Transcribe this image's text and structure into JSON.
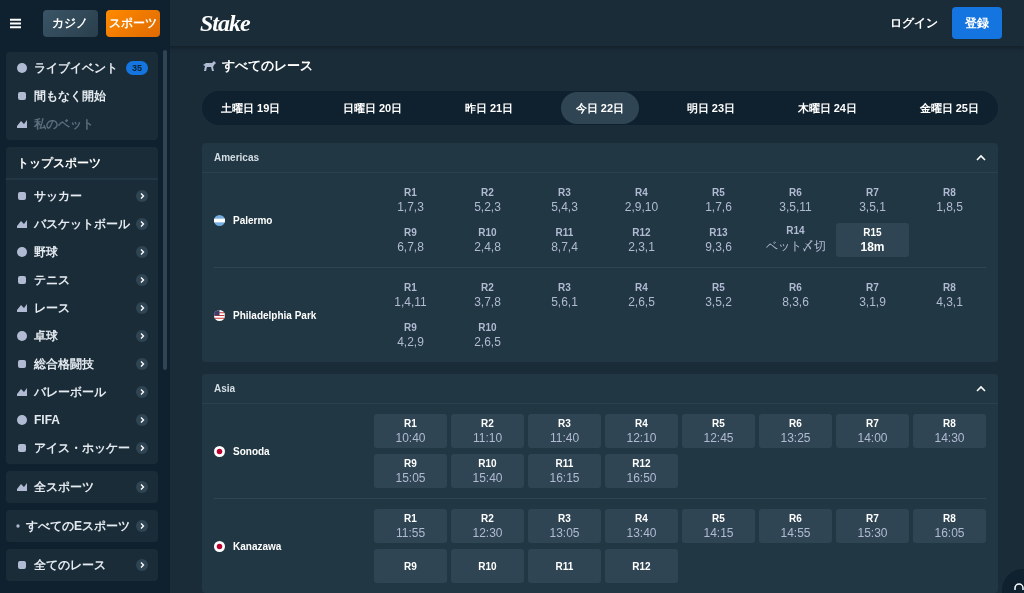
{
  "header": {
    "tabs": [
      {
        "label": "カジノ",
        "selected": false
      },
      {
        "label": "スポーツ",
        "selected": true
      }
    ],
    "logo": "Stake",
    "login": "ログイン",
    "register": "登録"
  },
  "sidebar": {
    "groups": [
      {
        "kind": "menu",
        "items": [
          {
            "label": "ライブイベント",
            "badge": "35",
            "disabled": false
          },
          {
            "label": "間もなく開始",
            "disabled": false
          },
          {
            "label": "私のベット",
            "disabled": true
          }
        ]
      },
      {
        "kind": "list",
        "title": "トップスポーツ",
        "items": [
          {
            "label": "サッカー"
          },
          {
            "label": "バスケットボール"
          },
          {
            "label": "野球"
          },
          {
            "label": "テニス"
          },
          {
            "label": "レース"
          },
          {
            "label": "卓球"
          },
          {
            "label": "総合格闘技"
          },
          {
            "label": "バレーボール"
          },
          {
            "label": "FIFA"
          },
          {
            "label": "アイス・ホッケー"
          }
        ]
      },
      {
        "kind": "list",
        "items": [
          {
            "label": "全スポーツ"
          }
        ]
      },
      {
        "kind": "list",
        "items": [
          {
            "label": "すべてのEスポーツ"
          }
        ]
      },
      {
        "kind": "list",
        "items": [
          {
            "label": "全てのレース"
          }
        ]
      }
    ]
  },
  "page": {
    "title": "すべてのレース",
    "dates": [
      {
        "label": "土曜日 19日",
        "selected": false
      },
      {
        "label": "日曜日 20日",
        "selected": false
      },
      {
        "label": "昨日 21日",
        "selected": false
      },
      {
        "label": "今日 22日",
        "selected": true
      },
      {
        "label": "明日 23日",
        "selected": false
      },
      {
        "label": "木曜日 24日",
        "selected": false
      },
      {
        "label": "金曜日 25日",
        "selected": false
      }
    ],
    "regions": [
      {
        "name": "Americas",
        "expanded": true,
        "tracks": [
          {
            "name": "Palermo",
            "kind": "argentina",
            "races": [
              {
                "kind": "result",
                "label": "R1",
                "info": "1,7,3"
              },
              {
                "kind": "result",
                "label": "R2",
                "info": "5,2,3"
              },
              {
                "kind": "result",
                "label": "R3",
                "info": "5,4,3"
              },
              {
                "kind": "result",
                "label": "R4",
                "info": "2,9,10"
              },
              {
                "kind": "result",
                "label": "R5",
                "info": "1,7,6"
              },
              {
                "kind": "result",
                "label": "R6",
                "info": "3,5,11"
              },
              {
                "kind": "result",
                "label": "R7",
                "info": "3,5,1"
              },
              {
                "kind": "result",
                "label": "R8",
                "info": "1,8,5"
              },
              {
                "kind": "result",
                "label": "R9",
                "info": "6,7,8"
              },
              {
                "kind": "result",
                "label": "R10",
                "info": "2,4,8"
              },
              {
                "kind": "result",
                "label": "R11",
                "info": "8,7,4"
              },
              {
                "kind": "result",
                "label": "R12",
                "info": "2,3,1"
              },
              {
                "kind": "result",
                "label": "R13",
                "info": "9,3,6"
              },
              {
                "kind": "result",
                "label": "R14",
                "info": "ベット〆切"
              },
              {
                "kind": "next",
                "label": "R15",
                "info": "18m"
              }
            ]
          },
          {
            "name": "Philadelphia Park",
            "kind": "usa",
            "races": [
              {
                "kind": "result",
                "label": "R1",
                "info": "1,4,11"
              },
              {
                "kind": "result",
                "label": "R2",
                "info": "3,7,8"
              },
              {
                "kind": "result",
                "label": "R3",
                "info": "5,6,1"
              },
              {
                "kind": "result",
                "label": "R4",
                "info": "2,6,5"
              },
              {
                "kind": "result",
                "label": "R5",
                "info": "3,5,2"
              },
              {
                "kind": "result",
                "label": "R6",
                "info": "8,3,6"
              },
              {
                "kind": "result",
                "label": "R7",
                "info": "3,1,9"
              },
              {
                "kind": "result",
                "label": "R8",
                "info": "4,3,1"
              },
              {
                "kind": "result",
                "label": "R9",
                "info": "4,2,9"
              },
              {
                "kind": "result",
                "label": "R10",
                "info": "2,6,5"
              }
            ]
          }
        ]
      },
      {
        "name": "Asia",
        "expanded": true,
        "tracks": [
          {
            "name": "Sonoda",
            "kind": "japan",
            "races": [
              {
                "kind": "upcoming",
                "label": "R1",
                "info": "10:40"
              },
              {
                "kind": "upcoming",
                "label": "R2",
                "info": "11:10"
              },
              {
                "kind": "upcoming",
                "label": "R3",
                "info": "11:40"
              },
              {
                "kind": "upcoming",
                "label": "R4",
                "info": "12:10"
              },
              {
                "kind": "upcoming",
                "label": "R5",
                "info": "12:45"
              },
              {
                "kind": "upcoming",
                "label": "R6",
                "info": "13:25"
              },
              {
                "kind": "upcoming",
                "label": "R7",
                "info": "14:00"
              },
              {
                "kind": "upcoming",
                "label": "R8",
                "info": "14:30"
              },
              {
                "kind": "upcoming",
                "label": "R9",
                "info": "15:05"
              },
              {
                "kind": "upcoming",
                "label": "R10",
                "info": "15:40"
              },
              {
                "kind": "upcoming",
                "label": "R11",
                "info": "16:15"
              },
              {
                "kind": "upcoming",
                "label": "R12",
                "info": "16:50"
              }
            ]
          },
          {
            "name": "Kanazawa",
            "kind": "japan",
            "races": [
              {
                "kind": "upcoming",
                "label": "R1",
                "info": "11:55"
              },
              {
                "kind": "upcoming",
                "label": "R2",
                "info": "12:30"
              },
              {
                "kind": "upcoming",
                "label": "R3",
                "info": "13:05"
              },
              {
                "kind": "upcoming",
                "label": "R4",
                "info": "13:40"
              },
              {
                "kind": "upcoming",
                "label": "R5",
                "info": "14:15"
              },
              {
                "kind": "upcoming",
                "label": "R6",
                "info": "14:55"
              },
              {
                "kind": "upcoming",
                "label": "R7",
                "info": "15:30"
              },
              {
                "kind": "upcoming",
                "label": "R8",
                "info": "16:05"
              },
              {
                "kind": "upcoming",
                "label": "R9"
              },
              {
                "kind": "upcoming",
                "label": "R10"
              },
              {
                "kind": "upcoming",
                "label": "R11"
              },
              {
                "kind": "upcoming",
                "label": "R12"
              }
            ]
          }
        ]
      }
    ]
  }
}
